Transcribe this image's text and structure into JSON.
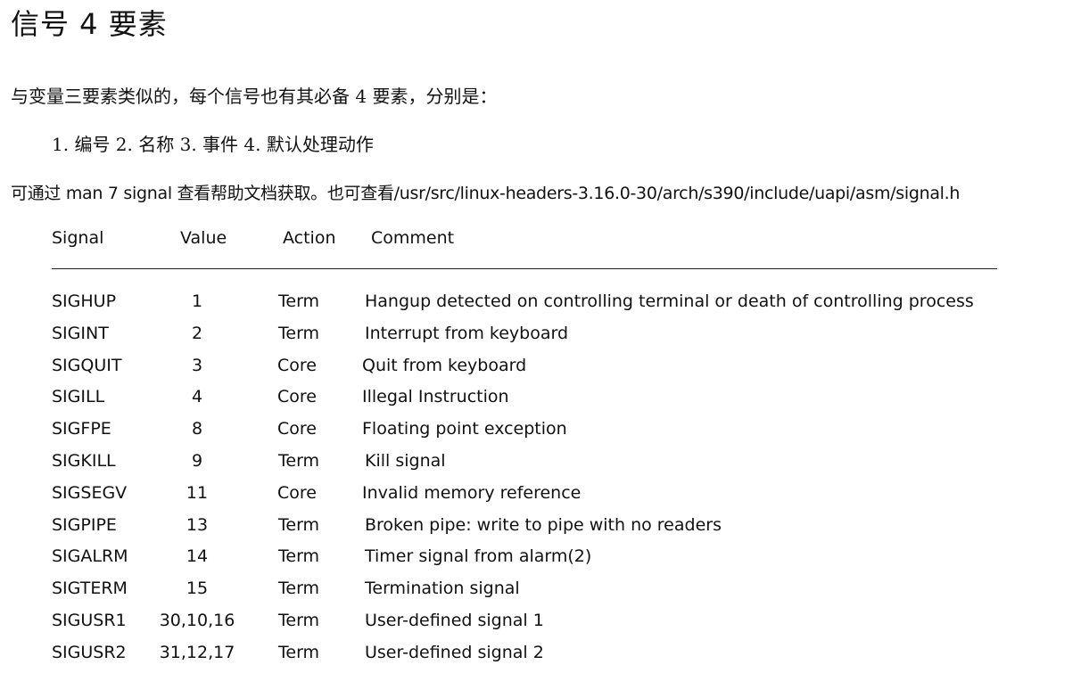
{
  "doc": {
    "title": "信号 4 要素",
    "intro": "与变量三要素类似的，每个信号也有其必备 4 要素，分别是：",
    "elements_line": "1. 编号  2. 名称  3. 事件  4. 默认处理动作",
    "reference_line": "可通过 man 7 signal 查看帮助文档获取。也可查看/usr/src/linux-headers-3.16.0-30/arch/s390/include/uapi/asm/signal.h"
  },
  "table": {
    "headers": {
      "signal": "Signal",
      "value": "Value",
      "action": "Action",
      "comment": "Comment"
    },
    "rows": [
      {
        "signal": "SIGHUP",
        "value": "1",
        "action": "Term",
        "comment": "Hangup detected on controlling terminal or death of controlling process"
      },
      {
        "signal": "SIGINT",
        "value": "2",
        "action": "Term",
        "comment": "Interrupt from keyboard"
      },
      {
        "signal": "SIGQUIT",
        "value": "3",
        "action": "Core",
        "comment": "Quit from keyboard"
      },
      {
        "signal": "SIGILL",
        "value": "4",
        "action": "Core",
        "comment": "Illegal Instruction"
      },
      {
        "signal": "SIGFPE",
        "value": "8",
        "action": "Core",
        "comment": "Floating point exception"
      },
      {
        "signal": "SIGKILL",
        "value": "9",
        "action": "Term",
        "comment": "Kill signal"
      },
      {
        "signal": "SIGSEGV",
        "value": "11",
        "action": "Core",
        "comment": "Invalid memory reference"
      },
      {
        "signal": "SIGPIPE",
        "value": "13",
        "action": "Term",
        "comment": "Broken pipe: write to pipe with no readers"
      },
      {
        "signal": "SIGALRM",
        "value": "14",
        "action": "Term",
        "comment": "Timer signal from alarm(2)"
      },
      {
        "signal": "SIGTERM",
        "value": "15",
        "action": "Term",
        "comment": "Termination signal"
      },
      {
        "signal": "SIGUSR1",
        "value": "30,10,16",
        "action": "Term",
        "comment": "User-defined signal 1"
      },
      {
        "signal": "SIGUSR2",
        "value": "31,12,17",
        "action": "Term",
        "comment": "User-defined signal 2"
      }
    ]
  }
}
